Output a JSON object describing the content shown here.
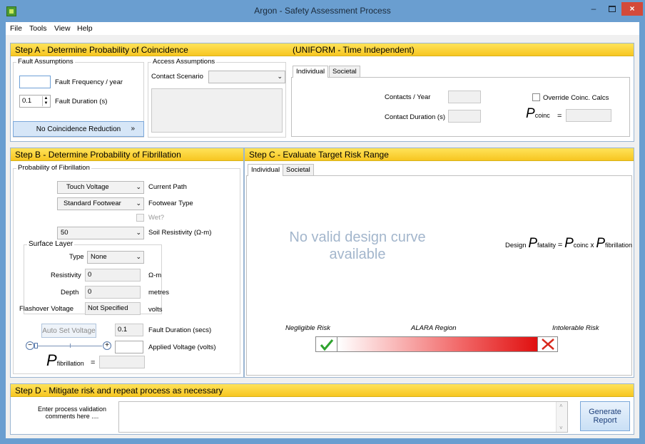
{
  "window": {
    "title": "Argon - Safety Assessment Process",
    "min_label": "–",
    "close_label": "×"
  },
  "menu": [
    "File",
    "Tools",
    "View",
    "Help"
  ],
  "stepA": {
    "title": "Step A - Determine Probability of Coincidence",
    "subtitle": "(UNIFORM - Time Independent)",
    "fault_group": "Fault Assumptions",
    "fault_frequency_label": "Fault Frequency / year",
    "fault_frequency_value": "",
    "fault_duration_label": "Fault Duration (s)",
    "fault_duration_value": "0.1",
    "no_coincidence_button": "No Coincidence Reduction",
    "no_coincidence_chevron": "»",
    "access_group": "Access Assumptions",
    "contact_scenario_label": "Contact Scenario",
    "contact_scenario_value": "",
    "tabs": [
      "Individual",
      "Societal"
    ],
    "contacts_per_year_label": "Contacts / Year",
    "contact_duration_label": "Contact Duration (s)",
    "override_label": "Override Coinc. Calcs",
    "p_symbol": "P",
    "p_sub": "coinc",
    "equals": "="
  },
  "stepB": {
    "title": "Step B - Determine Probability of Fibrillation",
    "group": "Probability of Fibrillation",
    "current_path_value": "Touch Voltage",
    "current_path_label": "Current Path",
    "footwear_value": "Standard Footwear",
    "footwear_label": "Footwear Type",
    "wet_label": "Wet?",
    "soil_value": "50",
    "soil_label": "Soil Resistivity (Ω-m)",
    "surface_group": "Surface Layer",
    "type_label": "Type",
    "type_value": "None",
    "resistivity_label": "Resistivity",
    "resistivity_value": "0",
    "resistivity_unit": "Ω-m",
    "depth_label": "Depth",
    "depth_value": "0",
    "depth_unit": "metres",
    "flashover_label": "Flashover Voltage",
    "flashover_value": "Not Specified",
    "flashover_unit": "volts",
    "auto_set_button": "Auto Set Voltage",
    "fault_duration_value": "0.1",
    "fault_duration_label": "Fault Duration  (secs)",
    "applied_voltage_label": "Applied Voltage (volts)",
    "applied_voltage_value": "",
    "p_symbol": "P",
    "p_sub": "fibrillation",
    "equals": "="
  },
  "stepC": {
    "title": "Step C - Evaluate Target Risk Range",
    "tabs": [
      "Individual",
      "Societal"
    ],
    "no_curve_message": "No valid design curve available",
    "design_label": "Design",
    "p_symbol": "P",
    "fatality_sub": "fatality",
    "coinc_sub": "coinc",
    "fibrillation_sub": "fibrillation",
    "equals": "=",
    "times": "x",
    "negligible_label": "Negligible Risk",
    "alara_label": "ALARA Region",
    "intolerable_label": "Intolerable Risk"
  },
  "stepD": {
    "title": "Step D - Mitigate risk and repeat process as necessary",
    "comments_label": "Enter process validation comments here ....",
    "comments_value": "",
    "generate_button": "Generate Report"
  },
  "colors": {
    "accent": "#f7c621",
    "window": "#6a9ed0",
    "risk_red": "#e01010",
    "check_green": "#2ea32e"
  }
}
